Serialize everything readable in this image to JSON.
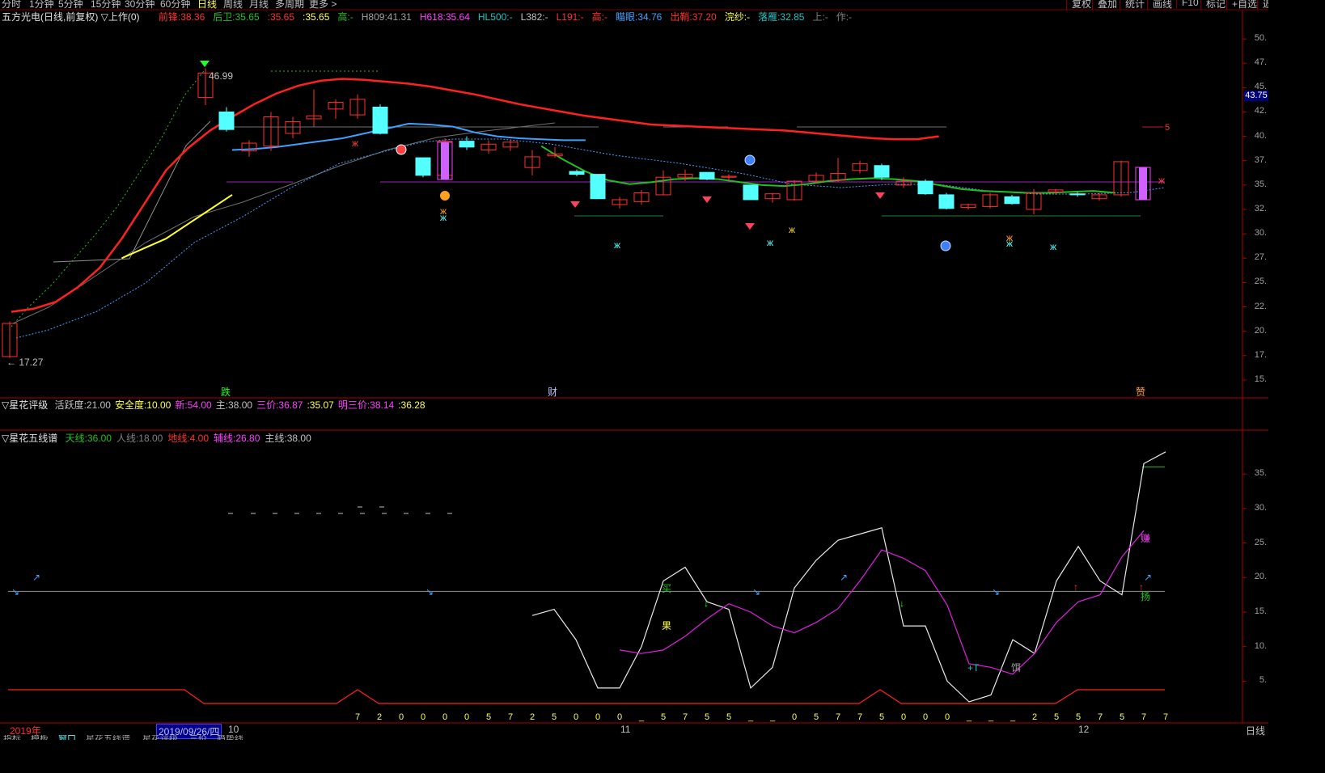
{
  "topbar": {
    "periods": [
      "分时",
      "1分钟",
      "5分钟",
      "15分钟",
      "30分钟",
      "60分钟",
      "日线",
      "周线",
      "月线",
      "多周期",
      "更多 >"
    ],
    "active_period": "日线",
    "buttons": [
      "复权",
      "叠加",
      "统计",
      "画线",
      "F10",
      "标记",
      "+自选",
      "返"
    ]
  },
  "main_info": {
    "title": "五方光电(日线,前复权) ▽上作(0)",
    "items": [
      {
        "label": "前锋:",
        "value": "38.36",
        "color": "#ff3030"
      },
      {
        "label": "后卫:",
        "value": "35.65",
        "color": "#20c020"
      },
      {
        "label": ":",
        "value": "35.65",
        "color": "#ff3030"
      },
      {
        "label": ":",
        "value": "35.65",
        "color": "#ffff54"
      },
      {
        "label": "高:",
        "value": "-",
        "color": "#20c020"
      },
      {
        "label": "H809:",
        "value": "41.31",
        "color": "#a0a0a0"
      },
      {
        "label": "H618:",
        "value": "35.64",
        "color": "#ff40ff"
      },
      {
        "label": "HL500:",
        "value": "-",
        "color": "#20c0c0"
      },
      {
        "label": "L382:",
        "value": "-",
        "color": "#c0c0c0"
      },
      {
        "label": "L191:",
        "value": "-",
        "color": "#ff3030"
      },
      {
        "label": "高:",
        "value": "-",
        "color": "#ff3030"
      },
      {
        "label": "瞄眼:",
        "value": "34.76",
        "color": "#40a0ff"
      },
      {
        "label": "出鞘:",
        "value": "37.20",
        "color": "#ff3030"
      },
      {
        "label": "浣纱:",
        "value": "-",
        "color": "#ffff54"
      },
      {
        "label": "落雁:",
        "value": "32.85",
        "color": "#20c0c0"
      },
      {
        "label": "上:",
        "value": "-",
        "color": "#808080"
      },
      {
        "label": "作:",
        "value": "-",
        "color": "#808080"
      }
    ]
  },
  "rating_info": {
    "title": "▽星花评级",
    "items": [
      {
        "label": "活跃度:",
        "value": "21.00",
        "color": "#c0c0c0"
      },
      {
        "label": "安全度:",
        "value": "10.00",
        "color": "#ffff54"
      },
      {
        "label": "新:",
        "value": "54.00",
        "color": "#ff40ff"
      },
      {
        "label": "主:",
        "value": "38.00",
        "color": "#c0c0c0"
      },
      {
        "label": "三价:",
        "value": "36.87",
        "color": "#ff40ff"
      },
      {
        "label": ":",
        "value": "35.07",
        "color": "#ffff54"
      },
      {
        "label": "明三价:",
        "value": "38.14",
        "color": "#ff40ff"
      },
      {
        "label": ":",
        "value": "36.28",
        "color": "#ffff54"
      }
    ]
  },
  "five_line_info": {
    "title": "▽星花五线谱",
    "items": [
      {
        "label": "天线:",
        "value": "36.00",
        "color": "#20c020"
      },
      {
        "label": "人线:",
        "value": "18.00",
        "color": "#808080"
      },
      {
        "label": "地线:",
        "value": "4.00",
        "color": "#ff3030"
      },
      {
        "label": "辅线:",
        "value": "26.80",
        "color": "#ff40ff"
      },
      {
        "label": "主线:",
        "value": "38.00",
        "color": "#c0c0c0"
      }
    ]
  },
  "price_axis": [
    "50.",
    "47.",
    "45.",
    "42.",
    "40.",
    "37.",
    "35.",
    "32.",
    "30.",
    "27.",
    "25.",
    "22.",
    "20.",
    "17.",
    "15."
  ],
  "price_axis_values": [
    50,
    47.5,
    45,
    42.5,
    40,
    37.5,
    35,
    32.5,
    30,
    27.5,
    25,
    22.5,
    20,
    17.5,
    15
  ],
  "current_price_label": "43.75",
  "current_price_value": 43.75,
  "high_label": "46.99",
  "low_label": "17.27",
  "level_marker_label": "5",
  "lower_axis": [
    "35.",
    "30.",
    "25.",
    "20.",
    "15.",
    "10.",
    "5."
  ],
  "lower_axis_values": [
    35,
    30,
    25,
    20,
    15,
    10,
    5
  ],
  "bottom_markers": [
    {
      "text": "跌",
      "color": "#20ff20"
    },
    {
      "text": "财",
      "color": "#c0c0ff"
    },
    {
      "text": "赞",
      "color": "#ffa040"
    }
  ],
  "lower_labels": [
    {
      "text": "买",
      "color": "#20c020"
    },
    {
      "text": "果",
      "color": "#ffff54"
    },
    {
      "text": "+T",
      "color": "#20c0c0"
    },
    {
      "text": "饵",
      "color": "#a0a0a0"
    },
    {
      "text": "赚",
      "color": "#ff40ff"
    },
    {
      "text": "扬",
      "color": "#20c020"
    }
  ],
  "digit_row": [
    "7",
    "2",
    "0",
    "0",
    "0",
    "0",
    "5",
    "7",
    "2",
    "5",
    "0",
    "0",
    "0",
    "_",
    "5",
    "7",
    "5",
    "5",
    "_",
    "_",
    "0",
    "5",
    "7",
    "7",
    "5",
    "0",
    "0",
    "0",
    "_",
    "_",
    "_",
    "2",
    "5",
    "5",
    "7",
    "5",
    "7",
    "7"
  ],
  "date_axis": {
    "year": "2019年",
    "cursor_date": "2019/09/26/四",
    "month_marks": [
      "10",
      "11",
      "12"
    ]
  },
  "bottom_tabs": [
    "指标",
    "模板",
    "窗口",
    "星花五线谱",
    "星花评级",
    "三价",
    "趋势线"
  ],
  "right_period_label": "日线",
  "chart_data": {
    "type": "candlestick",
    "title": "五方光电(日线,前复权)",
    "ylim": [
      13.5,
      51.5
    ],
    "candles": [
      {
        "o": 17.4,
        "h": 21.0,
        "l": 17.27,
        "c": 20.8
      },
      {
        "o": 44.0,
        "h": 46.99,
        "l": 43.2,
        "c": 46.5
      },
      {
        "o": 42.5,
        "h": 43.0,
        "l": 40.5,
        "c": 40.7
      },
      {
        "o": 38.5,
        "h": 39.6,
        "l": 37.9,
        "c": 39.3
      },
      {
        "o": 39.0,
        "h": 42.5,
        "l": 38.5,
        "c": 42.0
      },
      {
        "o": 40.3,
        "h": 42.0,
        "l": 39.8,
        "c": 41.5
      },
      {
        "o": 41.8,
        "h": 44.8,
        "l": 41.0,
        "c": 42.1
      },
      {
        "o": 42.8,
        "h": 43.8,
        "l": 41.8,
        "c": 43.5
      },
      {
        "o": 42.2,
        "h": 44.3,
        "l": 41.8,
        "c": 43.8
      },
      {
        "o": 43.0,
        "h": 43.3,
        "l": 40.2,
        "c": 40.3
      },
      {
        "o": 37.8,
        "h": 37.8,
        "l": 35.8,
        "c": 36.0
      },
      {
        "o": 36.0,
        "h": 39.8,
        "l": 35.8,
        "c": 39.5
      },
      {
        "o": 39.5,
        "h": 40.0,
        "l": 38.6,
        "c": 38.9
      },
      {
        "o": 38.6,
        "h": 39.6,
        "l": 38.2,
        "c": 39.2
      },
      {
        "o": 38.9,
        "h": 39.7,
        "l": 38.5,
        "c": 39.4
      },
      {
        "o": 36.8,
        "h": 38.6,
        "l": 36.0,
        "c": 37.9
      },
      {
        "o": 38.0,
        "h": 38.9,
        "l": 37.8,
        "c": 38.2
      },
      {
        "o": 36.4,
        "h": 36.6,
        "l": 35.9,
        "c": 36.1
      },
      {
        "o": 36.1,
        "h": 36.1,
        "l": 33.6,
        "c": 33.6
      },
      {
        "o": 33.0,
        "h": 33.8,
        "l": 32.6,
        "c": 33.5
      },
      {
        "o": 33.3,
        "h": 34.5,
        "l": 33.0,
        "c": 34.2
      },
      {
        "o": 34.0,
        "h": 36.5,
        "l": 34.0,
        "c": 35.8
      },
      {
        "o": 35.8,
        "h": 36.6,
        "l": 35.4,
        "c": 36.1
      },
      {
        "o": 36.3,
        "h": 36.3,
        "l": 35.5,
        "c": 35.6
      },
      {
        "o": 35.8,
        "h": 36.1,
        "l": 35.5,
        "c": 35.9
      },
      {
        "o": 35.0,
        "h": 35.0,
        "l": 33.5,
        "c": 33.5
      },
      {
        "o": 33.6,
        "h": 34.2,
        "l": 33.2,
        "c": 34.1
      },
      {
        "o": 33.5,
        "h": 35.5,
        "l": 33.4,
        "c": 35.4
      },
      {
        "o": 35.4,
        "h": 36.3,
        "l": 35.2,
        "c": 36.0
      },
      {
        "o": 35.5,
        "h": 37.8,
        "l": 35.3,
        "c": 36.2
      },
      {
        "o": 36.5,
        "h": 37.5,
        "l": 36.2,
        "c": 37.2
      },
      {
        "o": 37.0,
        "h": 37.2,
        "l": 35.5,
        "c": 35.8
      },
      {
        "o": 35.0,
        "h": 35.8,
        "l": 34.7,
        "c": 35.4
      },
      {
        "o": 35.4,
        "h": 35.6,
        "l": 34.0,
        "c": 34.1
      },
      {
        "o": 34.0,
        "h": 34.2,
        "l": 32.5,
        "c": 32.6
      },
      {
        "o": 32.7,
        "h": 33.1,
        "l": 32.5,
        "c": 33.0
      },
      {
        "o": 32.8,
        "h": 34.2,
        "l": 32.6,
        "c": 34.0
      },
      {
        "o": 33.8,
        "h": 34.0,
        "l": 33.0,
        "c": 33.1
      },
      {
        "o": 32.5,
        "h": 34.6,
        "l": 32.0,
        "c": 34.2
      },
      {
        "o": 34.3,
        "h": 34.6,
        "l": 34.0,
        "c": 34.5
      },
      {
        "o": 34.1,
        "h": 34.3,
        "l": 33.8,
        "c": 34.0
      },
      {
        "o": 33.6,
        "h": 34.2,
        "l": 33.4,
        "c": 34.0
      },
      {
        "o": 34.0,
        "h": 37.5,
        "l": 33.8,
        "c": 37.4
      }
    ],
    "series": [
      {
        "name": "前锋",
        "color": "#ff2020",
        "values": [
          22.0,
          22.3,
          23.0,
          24.5,
          26.5,
          29.5,
          33.0,
          36.5,
          38.8,
          40.6,
          42.0,
          43.3,
          44.4,
          45.2,
          45.7,
          45.9,
          45.8,
          45.6,
          45.4,
          45.1,
          44.7,
          44.3,
          43.8,
          43.3,
          42.9,
          42.5,
          42.1,
          41.8,
          41.5,
          41.2,
          41.1,
          41.0,
          40.9,
          40.8,
          40.7,
          40.6,
          40.4,
          40.2,
          40.0,
          39.8,
          39.7,
          39.7,
          40.0
        ]
      },
      {
        "name": "后卫",
        "color": "#20c020",
        "values": [
          null,
          null,
          null,
          null,
          null,
          null,
          null,
          null,
          null,
          null,
          null,
          null,
          null,
          null,
          null,
          null,
          null,
          null,
          null,
          null,
          null,
          null,
          null,
          null,
          39.0,
          37.6,
          36.4,
          35.5,
          35.1,
          35.3,
          35.6,
          35.7,
          35.6,
          35.3,
          35.0,
          34.9,
          35.1,
          35.4,
          35.6,
          35.7,
          35.6,
          35.4,
          35.0,
          34.6,
          34.4,
          34.3,
          34.2,
          34.2,
          34.3,
          34.4,
          34.2
        ]
      },
      {
        "name": "瞄眼",
        "color": "#40a0ff",
        "values": [
          null,
          null,
          null,
          null,
          null,
          null,
          null,
          null,
          null,
          null,
          38.6,
          38.7,
          38.9,
          39.2,
          39.5,
          39.8,
          40.3,
          40.8,
          41.3,
          41.2,
          41.0,
          40.4,
          40.0,
          39.8,
          39.7,
          39.6,
          39.6
        ]
      },
      {
        "name": "黄线",
        "color": "#ffff30",
        "values": [
          null,
          null,
          null,
          null,
          null,
          27.5,
          28.5,
          29.5,
          31.0,
          32.5,
          34.0
        ]
      }
    ],
    "lower_chart": {
      "ylim": [
        2,
        39
      ],
      "white": [
        null,
        null,
        null,
        null,
        null,
        null,
        null,
        null,
        null,
        null,
        null,
        null,
        null,
        null,
        null,
        null,
        null,
        null,
        null,
        null,
        null,
        null,
        null,
        null,
        14.5,
        15.4,
        11.0,
        4.0,
        4.0,
        10.0,
        19.5,
        21.5,
        16.5,
        15.4,
        4.0,
        7.0,
        18.5,
        22.5,
        25.4,
        26.3,
        27.2,
        13.0,
        13.0,
        5.0,
        2.0,
        3.0,
        11.0,
        9.0,
        19.5,
        24.5,
        19.5,
        17.5,
        36.5,
        38.2
      ],
      "magenta": [
        null,
        null,
        null,
        null,
        null,
        null,
        null,
        null,
        null,
        null,
        null,
        null,
        null,
        null,
        null,
        null,
        null,
        null,
        null,
        null,
        null,
        null,
        null,
        null,
        null,
        null,
        null,
        null,
        9.5,
        9.0,
        9.5,
        11.5,
        14.0,
        16.2,
        15.0,
        13.0,
        12.0,
        13.5,
        15.5,
        19.5,
        24.0,
        22.8,
        21.0,
        16.0,
        7.5,
        7.0,
        6.0,
        9.0,
        13.5,
        16.5,
        17.5,
        23.0,
        26.8
      ],
      "gray_level": 18,
      "green_level": 36,
      "red_base": 4
    }
  }
}
